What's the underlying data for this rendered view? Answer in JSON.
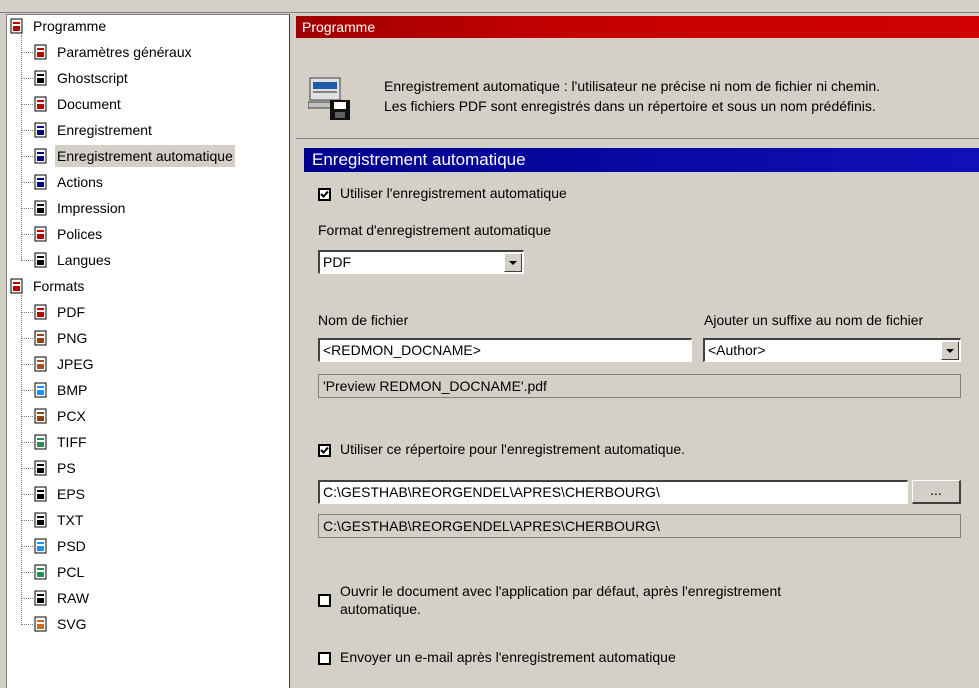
{
  "tree": {
    "items": [
      {
        "label": "Programme",
        "level": 0,
        "icon": "program-icon",
        "color": "#c00000"
      },
      {
        "label": "Paramètres généraux",
        "level": 1,
        "icon": "settings-icon",
        "color": "#c00000"
      },
      {
        "label": "Ghostscript",
        "level": 1,
        "icon": "ghostscript-icon",
        "color": "#000000"
      },
      {
        "label": "Document",
        "level": 1,
        "icon": "document-icon",
        "color": "#c00000"
      },
      {
        "label": "Enregistrement",
        "level": 1,
        "icon": "save-icon",
        "color": "#000080"
      },
      {
        "label": "Enregistrement automatique",
        "level": 1,
        "icon": "autosave-icon",
        "color": "#000080",
        "selected": true
      },
      {
        "label": "Actions",
        "level": 1,
        "icon": "actions-icon",
        "color": "#000080"
      },
      {
        "label": "Impression",
        "level": 1,
        "icon": "printer-icon",
        "color": "#000000"
      },
      {
        "label": "Polices",
        "level": 1,
        "icon": "fonts-icon",
        "color": "#c00000"
      },
      {
        "label": "Langues",
        "level": 1,
        "icon": "languages-icon",
        "color": "#000000"
      },
      {
        "label": "Formats",
        "level": 0,
        "icon": "formats-icon",
        "color": "#c00000"
      },
      {
        "label": "PDF",
        "level": 1,
        "icon": "pdf-format-icon",
        "color": "#c00000"
      },
      {
        "label": "PNG",
        "level": 1,
        "icon": "png-format-icon",
        "color": "#8b4513"
      },
      {
        "label": "JPEG",
        "level": 1,
        "icon": "jpeg-format-icon",
        "color": "#a0522d"
      },
      {
        "label": "BMP",
        "level": 1,
        "icon": "bmp-format-icon",
        "color": "#1e90ff"
      },
      {
        "label": "PCX",
        "level": 1,
        "icon": "pcx-format-icon",
        "color": "#8b4513"
      },
      {
        "label": "TIFF",
        "level": 1,
        "icon": "tiff-format-icon",
        "color": "#2e8b57"
      },
      {
        "label": "PS",
        "level": 1,
        "icon": "ps-format-icon",
        "color": "#000000"
      },
      {
        "label": "EPS",
        "level": 1,
        "icon": "eps-format-icon",
        "color": "#000000"
      },
      {
        "label": "TXT",
        "level": 1,
        "icon": "txt-format-icon",
        "color": "#000000"
      },
      {
        "label": "PSD",
        "level": 1,
        "icon": "psd-format-icon",
        "color": "#1e90ff"
      },
      {
        "label": "PCL",
        "level": 1,
        "icon": "pcl-format-icon",
        "color": "#2e8b57"
      },
      {
        "label": "RAW",
        "level": 1,
        "icon": "raw-format-icon",
        "color": "#000000"
      },
      {
        "label": "SVG",
        "level": 1,
        "icon": "svg-format-icon",
        "color": "#d2691e"
      }
    ]
  },
  "header": {
    "section_title": "Programme",
    "description_line1": "Enregistrement automatique : l'utilisateur ne précise ni nom de fichier ni chemin.",
    "description_line2": "Les fichiers PDF sont enregistrés dans un répertoire et sous un nom prédéfinis."
  },
  "panel": {
    "title": "Enregistrement automatique",
    "use_autosave_label": "Utiliser l'enregistrement automatique",
    "use_autosave_checked": true,
    "format_label": "Format d'enregistrement automatique",
    "format_value": "PDF",
    "filename_label": "Nom de fichier",
    "filename_value": "<REDMON_DOCNAME>",
    "suffix_label": "Ajouter un suffixe au nom de fichier",
    "suffix_value": "<Author>",
    "filename_preview": "'Preview REDMON_DOCNAME'.pdf",
    "use_directory_label": "Utiliser ce répertoire pour l'enregistrement automatique.",
    "use_directory_checked": true,
    "directory_value": "C:\\GESTHAB\\REORGENDEL\\APRES\\CHERBOURG\\",
    "browse_label": "...",
    "directory_preview": "C:\\GESTHAB\\REORGENDEL\\APRES\\CHERBOURG\\",
    "open_doc_label_line1": "Ouvrir le document avec l'application par défaut, après l'enregistrement",
    "open_doc_label_line2": "automatique.",
    "open_doc_checked": false,
    "email_label": "Envoyer un e-mail après l'enregistrement automatique",
    "email_checked": false
  },
  "colors": {
    "section_red": "#c00000",
    "section_blue": "#00008b",
    "window_bg": "#d4d0c8"
  }
}
